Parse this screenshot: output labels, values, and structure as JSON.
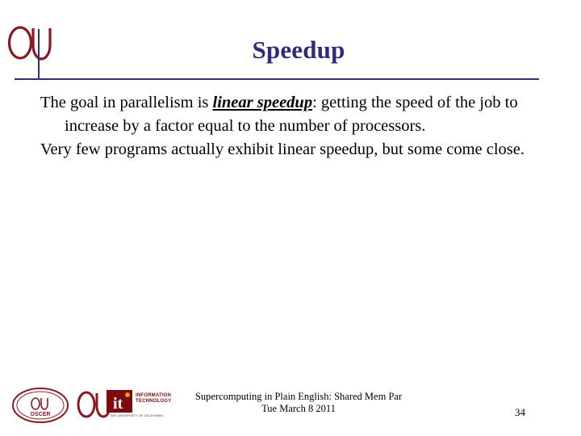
{
  "slide": {
    "title": "Speedup",
    "paragraphs": [
      {
        "lead": "The goal in parallelism is ",
        "emphasis": "linear speedup",
        "tail": ": getting the speed of the job to increase by a factor equal to the number of processors."
      },
      {
        "lead": "Very few programs actually exhibit linear speedup, but some come close.",
        "emphasis": "",
        "tail": ""
      }
    ],
    "footer": {
      "line1": "Supercomputing in Plain English: Shared Mem Par",
      "line2": "Tue March 8 2011",
      "slide_number": "34"
    },
    "logos": {
      "ou_header": "ou-logo",
      "oscer": "oscer-logo",
      "ou_small": "ou-logo-small",
      "it": "ou-information-technology-logo",
      "it_main_line1": "INFORMATION",
      "it_main_line2": "TECHNOLOGY",
      "it_sub": "THE UNIVERSITY OF OKLAHOMA"
    },
    "colors": {
      "title": "#2b2b7f",
      "rule": "#2f2f7a",
      "crimson": "#7c0b10",
      "background": "#ffffff"
    }
  }
}
